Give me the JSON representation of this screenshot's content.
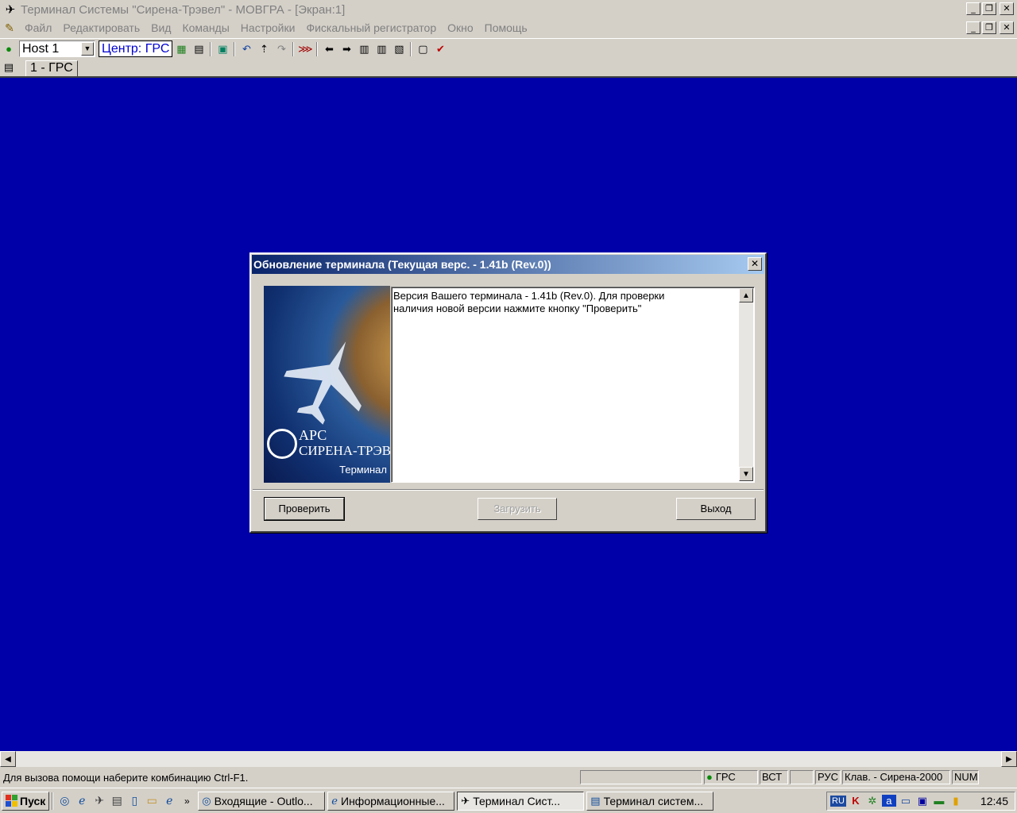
{
  "window": {
    "title": "Терминал Системы \"Сирена-Трэвел\" - МОВГРА - [Экран:1]",
    "minimize": "_",
    "restore": "❐",
    "close": "✕"
  },
  "menu": {
    "items": [
      "Файл",
      "Редактировать",
      "Вид",
      "Команды",
      "Настройки",
      "Фискальный регистратор",
      "Окно",
      "Помощь"
    ]
  },
  "toolbar": {
    "host": "Host 1",
    "center_label": "Центр: ГРС"
  },
  "tabs": [
    "1 - ГРС"
  ],
  "dialog": {
    "title": "Обновление терминала (Текущая верс. - 1.41b (Rev.0))",
    "message": "Версия Вашего терминала - 1.41b (Rev.0). Для проверки\nналичия новой версии нажмите кнопку \"Проверить\"",
    "brand_line1": "АРС",
    "brand_line2": "СИРЕНА-ТРЭВЕЛ",
    "brand_line3": "Терминал",
    "buttons": {
      "check": "Проверить",
      "download": "Загрузить",
      "exit": "Выход"
    }
  },
  "statusbar": {
    "hint": "Для вызова помощи наберите комбинацию Ctrl-F1.",
    "center": "ГРС",
    "mode": "ВСТ",
    "lang": "РУС",
    "keyboard": "Клав. - Сирена-2000",
    "num": "NUM"
  },
  "taskbar": {
    "start": "Пуск",
    "tasks": [
      "Входящие - Outlo...",
      "Информационные...",
      "Терминал Сист...",
      "Терминал систем..."
    ],
    "tray_lang": "RU",
    "clock": "12:45"
  },
  "colors": {
    "workspace": "#0000a8",
    "dialog_title_start": "#0a246a",
    "dialog_title_end": "#a6caf0"
  }
}
